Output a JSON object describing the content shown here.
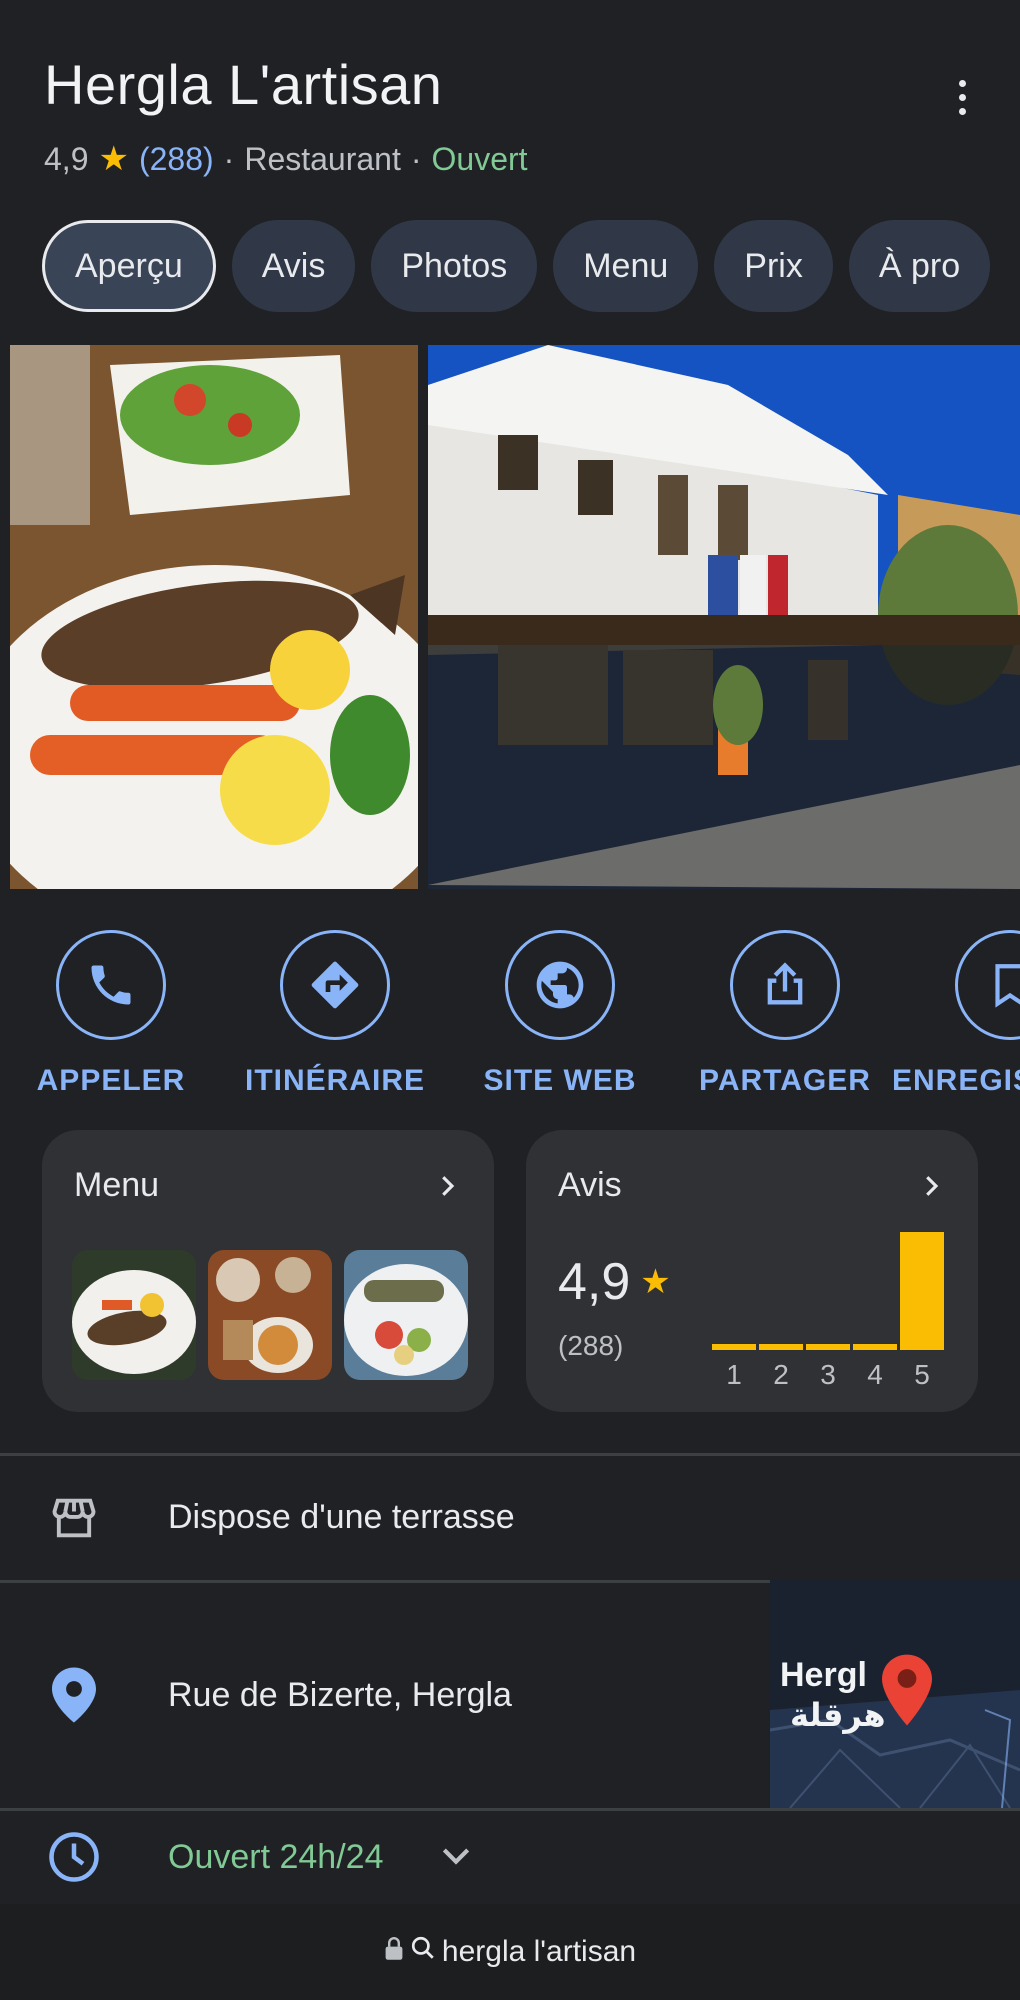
{
  "header": {
    "title": "Hergla L'artisan",
    "rating": "4,9",
    "review_count": "(288)",
    "category": "Restaurant",
    "separator": "·",
    "status": "Ouvert"
  },
  "tabs": [
    {
      "label": "Aperçu",
      "active": true
    },
    {
      "label": "Avis"
    },
    {
      "label": "Photos"
    },
    {
      "label": "Menu"
    },
    {
      "label": "Prix"
    },
    {
      "label": "À pro"
    }
  ],
  "actions": [
    {
      "label": "APPELER",
      "icon": "phone-icon"
    },
    {
      "label": "ITINÉRAIRE",
      "icon": "directions-icon"
    },
    {
      "label": "SITE WEB",
      "icon": "globe-icon"
    },
    {
      "label": "PARTAGER",
      "icon": "share-icon"
    },
    {
      "label": "ENREGIS",
      "icon": "bookmark-icon"
    }
  ],
  "menu_card": {
    "title": "Menu"
  },
  "reviews_card": {
    "title": "Avis",
    "rating": "4,9",
    "count": "(288)",
    "distribution": [
      {
        "stars": "1",
        "fraction": 0.02
      },
      {
        "stars": "2",
        "fraction": 0.02
      },
      {
        "stars": "3",
        "fraction": 0.02
      },
      {
        "stars": "4",
        "fraction": 0.04
      },
      {
        "stars": "5",
        "fraction": 1.0
      }
    ]
  },
  "info": {
    "amenity": "Dispose d'une terrasse",
    "address": "Rue de Bizerte, Hergla",
    "hours": "Ouvert 24h/24",
    "map_label_latin": "Hergl",
    "map_label_arabic": "هرقلة"
  },
  "browser": {
    "url": "hergla l'artisan"
  },
  "colors": {
    "accent": "#8ab4f8",
    "open": "#81c995",
    "star": "#fbbc04",
    "pin": "#ea4335"
  }
}
